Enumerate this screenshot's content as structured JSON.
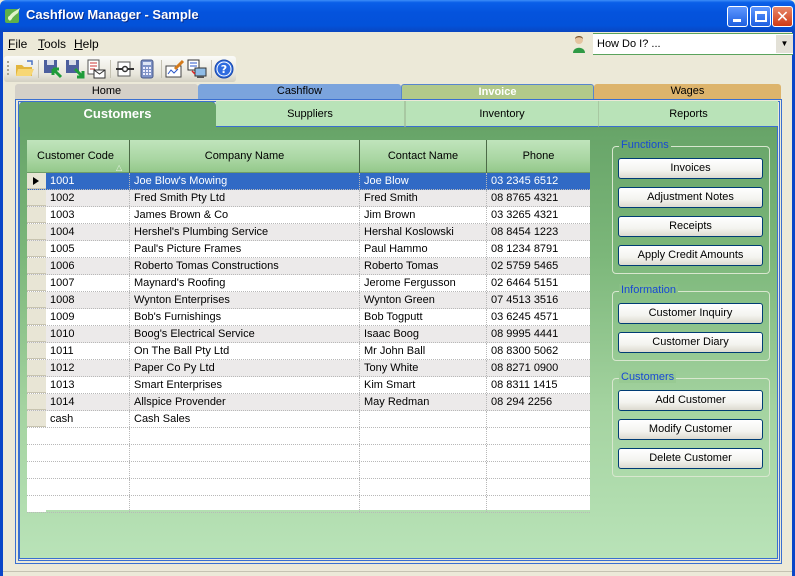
{
  "window": {
    "title": "Cashflow Manager - Sample"
  },
  "menu": {
    "items": [
      {
        "label": "File",
        "accel": "F",
        "rest": "ile"
      },
      {
        "label": "Tools",
        "accel": "T",
        "rest": "ools"
      },
      {
        "label": "Help",
        "accel": "H",
        "rest": "elp"
      }
    ]
  },
  "how_do_i": {
    "value": "How Do I? ..."
  },
  "toolbar": {
    "buttons": [
      {
        "icon": "open-folder-icon"
      },
      {
        "icon": "backup-save-icon"
      },
      {
        "icon": "restore-save-icon"
      },
      {
        "icon": "email-report-icon"
      },
      {
        "icon": "settings-tools-icon"
      },
      {
        "icon": "calculator-icon"
      },
      {
        "icon": "edit-form-icon"
      },
      {
        "icon": "network-computers-icon"
      },
      {
        "icon": "help-icon"
      }
    ]
  },
  "top_tabs": [
    {
      "label": "Home",
      "color": "#d4d0c8"
    },
    {
      "label": "Cashflow",
      "color": "#7ba4dd"
    },
    {
      "label": "Invoice",
      "color": "#b2c98a",
      "active": true
    },
    {
      "label": "Wages",
      "color": "#ddb46c"
    }
  ],
  "sub_tabs": [
    {
      "label": "Customers",
      "active": true
    },
    {
      "label": "Suppliers"
    },
    {
      "label": "Inventory"
    },
    {
      "label": "Reports"
    }
  ],
  "grid": {
    "columns": [
      "Customer Code",
      "Company Name",
      "Contact Name",
      "Phone"
    ],
    "sort_column": "Customer Code",
    "sort_direction": "ascending",
    "selected_row": 0,
    "rows": [
      {
        "code": "1001",
        "company": "Joe Blow's Mowing",
        "contact": "Joe Blow",
        "phone": "03 2345 6512"
      },
      {
        "code": "1002",
        "company": "Fred Smith Pty Ltd",
        "contact": "Fred Smith",
        "phone": "08 8765 4321"
      },
      {
        "code": "1003",
        "company": "James Brown & Co",
        "contact": "Jim Brown",
        "phone": "03 3265 4321"
      },
      {
        "code": "1004",
        "company": "Hershel's Plumbing Service",
        "contact": "Hershal Koslowski",
        "phone": "08 8454 1223"
      },
      {
        "code": "1005",
        "company": "Paul's Picture Frames",
        "contact": "Paul Hammo",
        "phone": "08 1234 8791"
      },
      {
        "code": "1006",
        "company": "Roberto Tomas Constructions",
        "contact": "Roberto Tomas",
        "phone": "02 5759 5465"
      },
      {
        "code": "1007",
        "company": "Maynard's Roofing",
        "contact": "Jerome Fergusson",
        "phone": "02 6464 5151"
      },
      {
        "code": "1008",
        "company": "Wynton Enterprises",
        "contact": "Wynton Green",
        "phone": "07 4513 3516"
      },
      {
        "code": "1009",
        "company": "Bob's Furnishings",
        "contact": "Bob Togputt",
        "phone": "03 6245 4571"
      },
      {
        "code": "1010",
        "company": "Boog's Electrical Service",
        "contact": "Isaac Boog",
        "phone": "08 9995 4441"
      },
      {
        "code": "1011",
        "company": "On The Ball Pty Ltd",
        "contact": "Mr John Ball",
        "phone": "08 8300 5062"
      },
      {
        "code": "1012",
        "company": "Paper Co Py Ltd",
        "contact": "Tony White",
        "phone": "08 8271 0900"
      },
      {
        "code": "1013",
        "company": "Smart Enterprises",
        "contact": "Kim Smart",
        "phone": "08 8311 1415"
      },
      {
        "code": "1014",
        "company": "Allspice Provender",
        "contact": "May Redman",
        "phone": "08 294 2256"
      },
      {
        "code": "cash",
        "company": "Cash Sales",
        "contact": "",
        "phone": ""
      }
    ],
    "empty_rows": 5
  },
  "groups": {
    "functions": {
      "title": "Functions",
      "buttons": [
        "Invoices",
        "Adjustment Notes",
        "Receipts",
        "Apply Credit Amounts"
      ]
    },
    "information": {
      "title": "Information",
      "buttons": [
        "Customer Inquiry",
        "Customer Diary"
      ]
    },
    "customers": {
      "title": "Customers",
      "buttons": [
        "Add Customer",
        "Modify Customer",
        "Delete Customer"
      ]
    }
  },
  "colors": {
    "selection": "#316ac5",
    "content_green": "#67a468",
    "legend_blue": "#1749d4"
  }
}
